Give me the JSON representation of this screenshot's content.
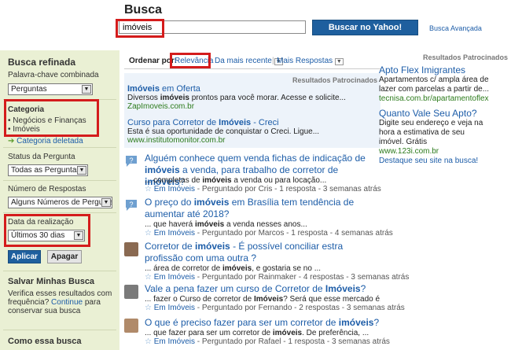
{
  "header": {
    "title": "Busca",
    "search_value": "imóveis",
    "search_button": "Buscar no Yahoo! Respostas",
    "advanced": "Busca Avançada"
  },
  "sidebar": {
    "refine_title": "Busca refinada",
    "keyword_label": "Palavra-chave combinada",
    "keyword_select": "Perguntas",
    "category_label": "Categoria",
    "categories": [
      "Negócios e Finanças",
      "Imóveis"
    ],
    "category_removed": "Categoria deletada",
    "status_label": "Status da Pergunta",
    "status_select": "Todas as Perguntas",
    "answers_label": "Número de Respostas",
    "answers_select": "Alguns Números de Perguntas",
    "date_label": "Data da realização",
    "date_select": "Últimos 30 dias",
    "apply": "Aplicar",
    "clear": "Apagar",
    "save_title": "Salvar Minhas Busca",
    "save_text_1": "Verifica esses resultados com",
    "save_text_2": "frequência?",
    "save_link": "Continue",
    "save_text_3": "para",
    "save_text_4": "conservar sua busca",
    "how_title": "Como essa busca"
  },
  "sort": {
    "label": "Ordenar por:",
    "relevance": "Relevância",
    "recent": "Da mais recente",
    "more_answers": "Mais Respostas"
  },
  "sponsored": {
    "label": "Resultados Patrocinados",
    "ads": [
      {
        "title_b": "Imóveis",
        "title_r": " em Oferta",
        "desc_a": "Diversos ",
        "desc_b": "imóveis",
        "desc_c": " prontos para você morar. Acesse e solicite...",
        "url": "ZapImoveis.com.br"
      },
      {
        "title_a": "Curso para Corretor de ",
        "title_b": "Imóveis",
        "title_c": " - Creci",
        "desc": "Esta é sua oportunidade de conquistar o Creci. Ligue...",
        "url": "www.institutomonitor.com.br"
      }
    ]
  },
  "questions": [
    {
      "t1": "Alguém conhece quem venda fichas de indicação de ",
      "tb": "imóveis",
      "t2": " a venda, para trabalho de corretor de ",
      "tb2": "imóveis",
      "t3": "?",
      "s1": "... completas de ",
      "sb": "imóveis",
      "s2": " a venda ou para locação...",
      "cat": "Em Imóveis",
      "meta": " - Perguntado por Cris - 1 resposta - 3 semanas atrás"
    },
    {
      "t1": "O preço do ",
      "tb": "imóveis",
      "t2": " em Brasília tem tendência de aumentar até 2018?",
      "s1": "... que haverá ",
      "sb": "imóveis",
      "s2": " a venda nesses anos...",
      "cat": "Em Imóveis",
      "meta": " - Perguntado por Marcos - 1 resposta - 4 semanas atrás"
    },
    {
      "t1": "Corretor de ",
      "tb": "imóveis",
      "t2": " - É possível conciliar estra profissão com uma outra ?",
      "s1": "... área de corretor de ",
      "sb": "imóveis",
      "s2": ", e gostaria se no ...",
      "cat": "Em Imóveis",
      "meta": " - Perguntado por Rainmaker - 4 respostas - 3 semanas atrás"
    },
    {
      "t1": "Vale a pena fazer um curso de Corretor de ",
      "tb": "Imóveis",
      "t2": "?",
      "s1": "... fazer o Curso de corretor de ",
      "sb": "Imóveis",
      "s2": "? Será que esse mercado é...",
      "cat": "Em Imóveis",
      "meta": " - Perguntado por Fernando - 2 respostas - 3 semanas atrás"
    },
    {
      "t1": "O que é preciso fazer para ser um corretor de ",
      "tb": "imóveis",
      "t2": "?",
      "s1": "... que fazer para ser um corretor de ",
      "sb": "imóveis",
      "s2": ". De preferência, ...",
      "cat": "Em Imóveis",
      "meta": " - Perguntado por Rafael - 1 resposta - 3 semanas atrás"
    }
  ],
  "right_ads": {
    "label": "Resultados Patrocinados",
    "ads": [
      {
        "title": "Apto Flex Imigrantes",
        "desc": [
          "Apartamentos c/ ampla área de",
          "lazer com parcelas a partir de...",
          "tecnisa.com.br/apartamentoflex"
        ]
      },
      {
        "title": "Quanto Vale Seu Apto?",
        "desc": [
          "Digite seu endereço e veja na",
          "hora a estimativa de seu",
          "imóvel. Grátis",
          "www.123i.com.br"
        ]
      }
    ],
    "promo": "Destaque seu site na busca!"
  }
}
